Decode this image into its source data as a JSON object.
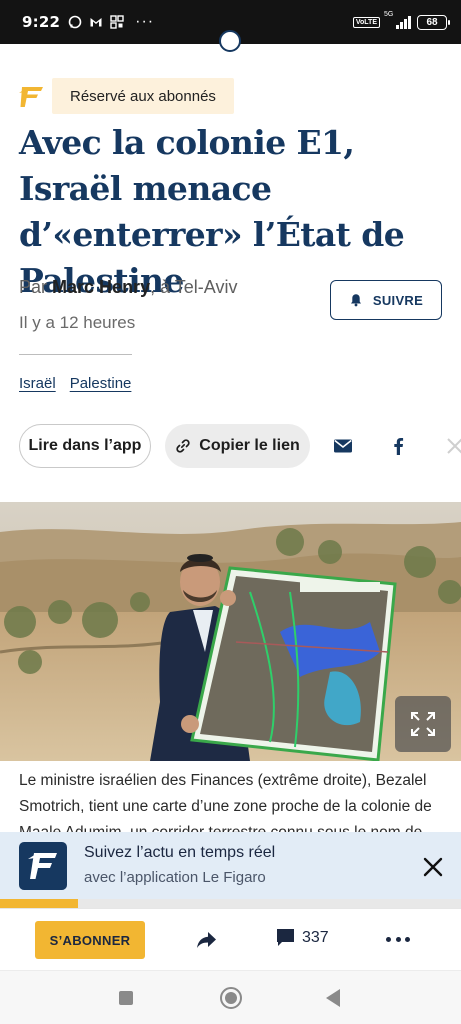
{
  "status_bar": {
    "time": "9:22",
    "icons_left": [
      "whatsapp-icon",
      "gmail-icon",
      "qr-apps-icon"
    ],
    "more": "···",
    "volte": "VoLTE",
    "network": "5G",
    "battery": "68"
  },
  "article": {
    "badge": "Réservé aux abonnés",
    "headline": "Avec la colonie E1, Israël menace d’«enterrer» l’État de Palestine",
    "byline_prefix": "Par",
    "author": "Marc Henry",
    "location": ", à Tel-Aviv",
    "time_ago": "Il y a 12 heures",
    "follow_label": "SUIVRE",
    "tags": [
      "Israël",
      "Palestine"
    ],
    "share": {
      "app_label": "Lire dans l’app",
      "copy_label": "Copier le lien",
      "icons": [
        "mail-icon",
        "facebook-icon",
        "x-icon"
      ]
    },
    "caption": "Le ministre israélien des Finances (extrême droite), Bezalel Smotrich, tient une carte d’une zone proche de la colonie de Maale Adumim, un corridor terrestre connu sous le nom de"
  },
  "app_banner": {
    "title": "Suivez l’actu en temps réel",
    "subtitle": "avec l’application Le Figaro",
    "progress": 0.17
  },
  "action_bar": {
    "subscribe_label": "S’ABONNER",
    "comment_count": "337"
  },
  "colors": {
    "brand_navy": "#163860",
    "gold": "#f2b632",
    "badge_bg": "#fdf1dc",
    "banner_bg": "#e2ecf6"
  }
}
